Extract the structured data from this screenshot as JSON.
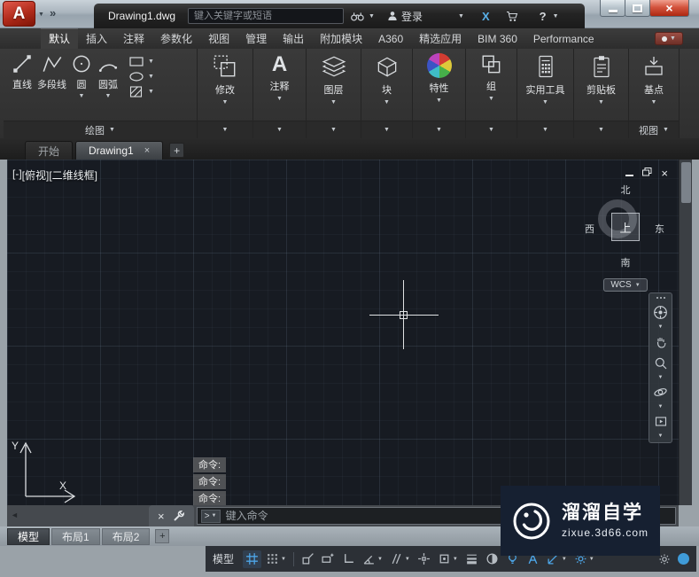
{
  "glyphs": {
    "down": "▼",
    "left_arrow": "◄",
    "overflow": "»",
    "close": "×",
    "plus": "+",
    "question": "?",
    "exchange_x": "X",
    "prompt": ">",
    "letter_a": "A"
  },
  "title_bar": {
    "logo_letter": "A",
    "document_title": "Drawing1.dwg",
    "search_placeholder": "键入关键字或短语",
    "sign_in_label": "登录"
  },
  "ribbon": {
    "tabs": [
      "默认",
      "插入",
      "注释",
      "参数化",
      "视图",
      "管理",
      "输出",
      "附加模块",
      "A360",
      "精选应用",
      "BIM 360",
      "Performance"
    ],
    "draw_panel_label": "绘图",
    "draw_tools": [
      {
        "label": "直线"
      },
      {
        "label": "多段线"
      },
      {
        "label": "圆"
      },
      {
        "label": "圆弧"
      }
    ],
    "panels": [
      {
        "label": "修改"
      },
      {
        "label": "注释"
      },
      {
        "label": "图层"
      },
      {
        "label": "块"
      },
      {
        "label": "特性"
      },
      {
        "label": "组"
      },
      {
        "label": "实用工具"
      },
      {
        "label": "剪贴板"
      },
      {
        "label": "基点"
      }
    ],
    "view_panel_label": "视图"
  },
  "file_tabs": {
    "start": "开始",
    "drawing": "Drawing1"
  },
  "canvas": {
    "viewport_controls": {
      "collapse": "[-]",
      "view": "[俯视]",
      "visual_style": "[二维线框]"
    },
    "viewcube": {
      "north": "北",
      "south": "南",
      "west": "西",
      "east": "东",
      "top": "上"
    },
    "wcs_label": "WCS",
    "ucs": {
      "x": "X",
      "y": "Y"
    },
    "command_history": [
      "命令:",
      "命令:",
      "命令:"
    ]
  },
  "command_line": {
    "placeholder": "键入命令"
  },
  "layout_tabs": {
    "model": "模型",
    "layout1": "布局1",
    "layout2": "布局2"
  },
  "status_bar": {
    "model_label": "模型"
  },
  "watermark": {
    "title": "溜溜自学",
    "url": "zixue.3d66.com"
  },
  "colors": {
    "accent_blue": "#3f9bd8",
    "close_red": "#c0392b",
    "canvas_bg": "#171b22"
  }
}
